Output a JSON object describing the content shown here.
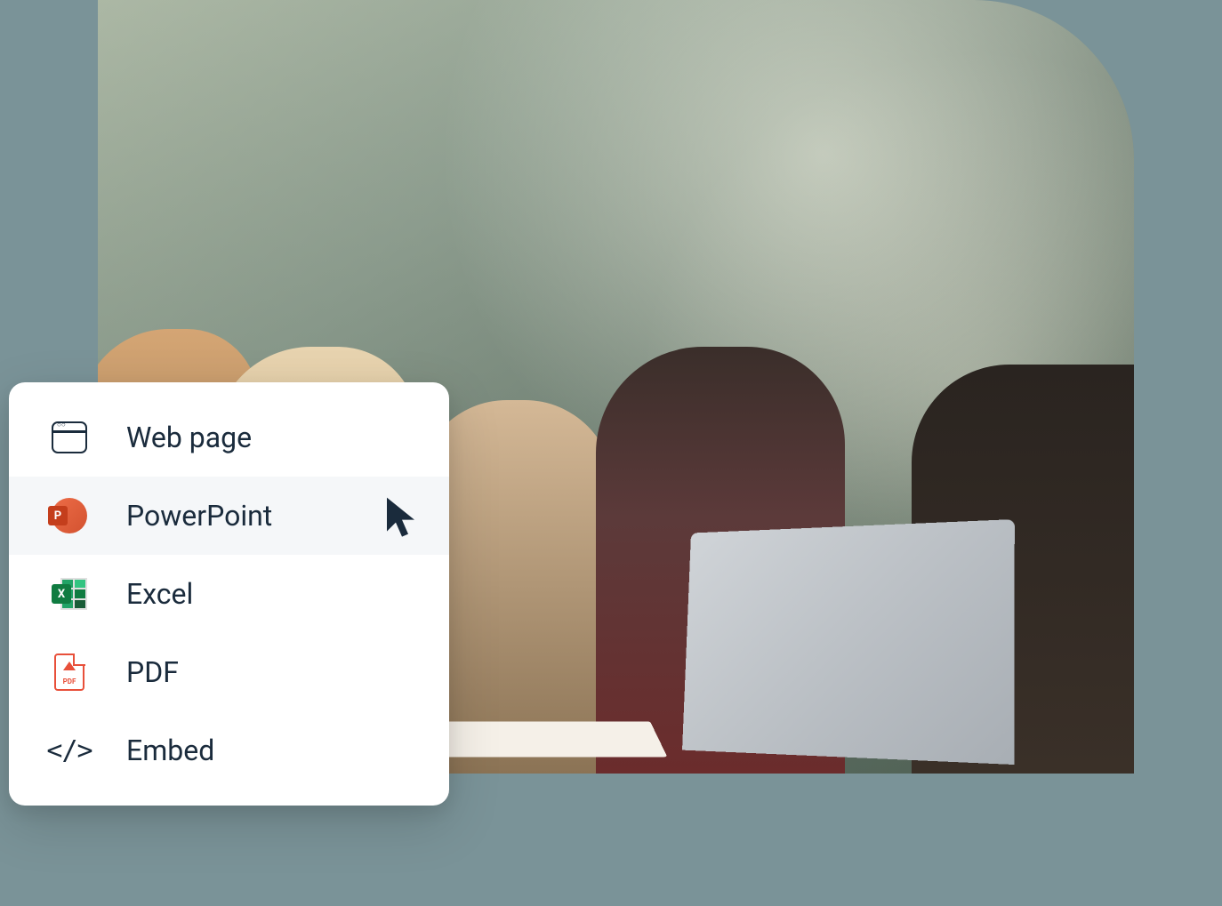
{
  "export_menu": {
    "items": [
      {
        "label": "Web page",
        "icon": "browser-icon"
      },
      {
        "label": "PowerPoint",
        "icon": "powerpoint-icon"
      },
      {
        "label": "Excel",
        "icon": "excel-icon"
      },
      {
        "label": "PDF",
        "icon": "pdf-icon"
      },
      {
        "label": "Embed",
        "icon": "embed-icon"
      }
    ],
    "highlighted_index": 1
  }
}
